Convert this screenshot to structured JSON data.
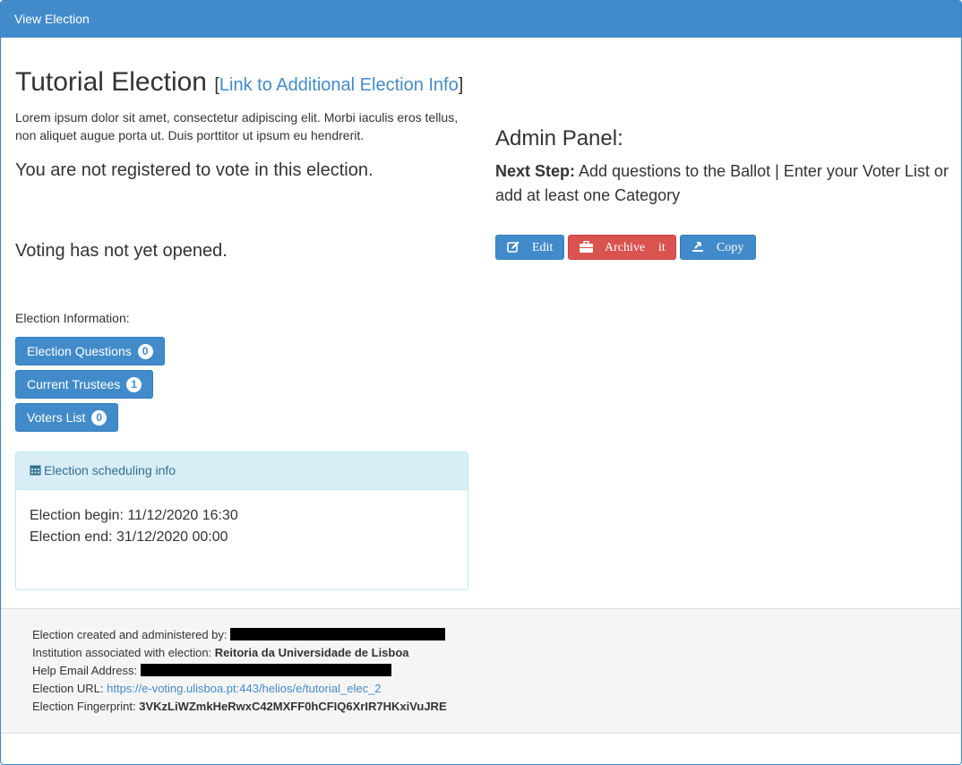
{
  "header": {
    "title": "View Election"
  },
  "election": {
    "name": "Tutorial Election",
    "bracket_open": "[",
    "info_link": "Link to Additional Election Info",
    "bracket_close": "]",
    "description": "Lorem ipsum dolor sit amet, consectetur adipiscing elit. Morbi iaculis eros tellus, non aliquet augue porta ut. Duis porttitor ut ipsum eu hendrerit.",
    "registration_status": "You are not registered to vote in this election.",
    "voting_status": "Voting has not yet opened."
  },
  "election_info": {
    "heading": "Election Information:",
    "buttons": [
      {
        "label": "Election Questions",
        "count": "0"
      },
      {
        "label": "Current Trustees",
        "count": "1"
      },
      {
        "label": "Voters List",
        "count": "0"
      }
    ]
  },
  "scheduling": {
    "heading": "Election scheduling info",
    "begin": "Election begin: 11/12/2020 16:30",
    "end": "Election end: 31/12/2020 00:00"
  },
  "admin": {
    "title": "Admin Panel:",
    "next_step_label": "Next Step:",
    "next_step_text": " Add questions to the Ballot | Enter your Voter List or add at least one Category",
    "edit_label": "Edit",
    "archive_label": "Archive",
    "archive_suffix": "it",
    "copy_label": "Copy"
  },
  "footer": {
    "created_by_label": "Election created and administered by:",
    "institution_label": "Institution associated with election:",
    "institution_value": "Reitoria da Universidade de Lisboa",
    "help_email_label": "Help Email Address:",
    "url_label": "Election URL:",
    "url_value": "https://e-voting.ulisboa.pt:443/helios/e/tutorial_elec_2",
    "fingerprint_label": "Election Fingerprint:",
    "fingerprint_value": "3VKzLiWZmkHeRwxC42MXFF0hCFIQ6XrIR7HKxiVuJRE"
  },
  "colors": {
    "primary": "#428bca",
    "danger": "#d9534f",
    "info_bg": "#d9edf7",
    "info_text": "#31708f",
    "footer_bg": "#f5f5f5"
  },
  "icons": [
    "edit-icon",
    "briefcase-icon",
    "copy-icon",
    "calendar-icon"
  ]
}
